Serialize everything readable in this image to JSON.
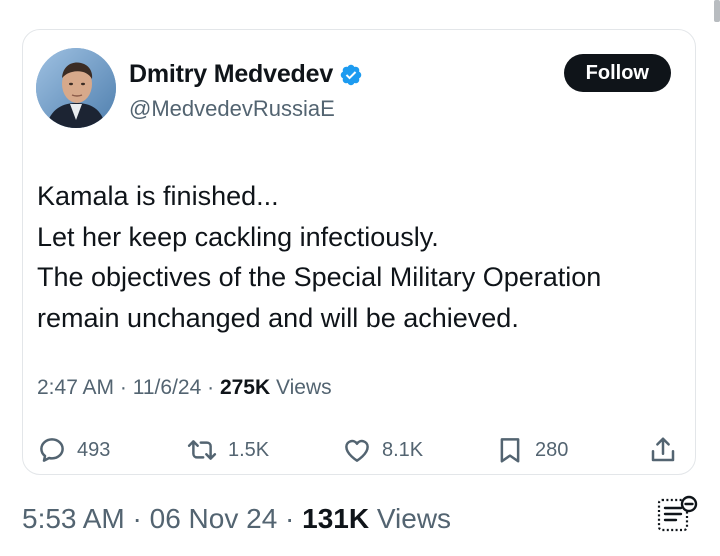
{
  "tweet": {
    "author": {
      "display_name": "Dmitry Medvedev",
      "handle": "@MedvedevRussiaE",
      "verified": true,
      "avatar_icon": "profile-photo"
    },
    "follow_label": "Follow",
    "text_lines": [
      "Kamala is finished...",
      "Let her keep cackling infectiously.",
      "The objectives of the Special Military Operation",
      "remain unchanged and will be achieved."
    ],
    "meta": {
      "time": "2:47 AM",
      "date": "11/6/24",
      "views_count": "275K",
      "views_label": "Views",
      "separator": "·"
    },
    "actions": {
      "replies": "493",
      "reposts": "1.5K",
      "likes": "8.1K",
      "bookmarks": "280"
    }
  },
  "repost_footer": {
    "time": "5:53 AM",
    "date": "06 Nov 24",
    "views_count": "131K",
    "views_label": "Views",
    "separator": "·"
  },
  "colors": {
    "text_primary": "#0f1419",
    "text_secondary": "#536471",
    "verified_badge": "#1d9bf0",
    "follow_button": "#0f1419",
    "border": "#e3e6e9"
  }
}
